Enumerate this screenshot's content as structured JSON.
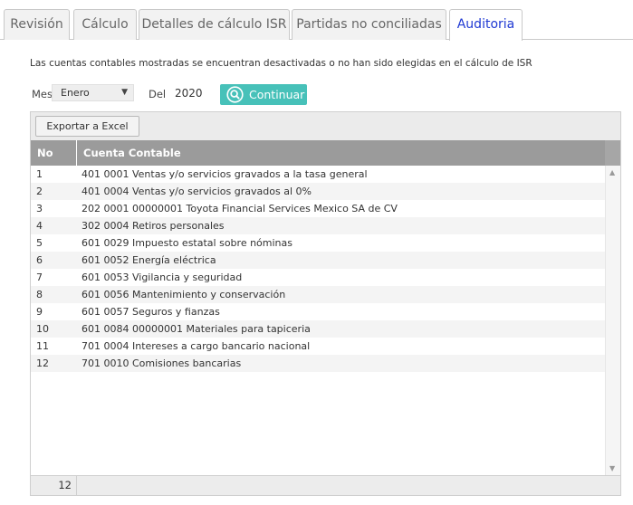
{
  "tabs": [
    {
      "label": "Revisión"
    },
    {
      "label": "Cálculo"
    },
    {
      "label": "Detalles de cálculo ISR"
    },
    {
      "label": "Partidas no conciliadas"
    },
    {
      "label": "Auditoria",
      "active": true
    }
  ],
  "notice": "Las cuentas contables mostradas se encuentran desactivadas o no han sido elegidas en el cálculo de ISR",
  "filters": {
    "mes_label": "Mes",
    "mes_value": "Enero",
    "del_label": "Del",
    "year": "2020",
    "continue_label": "Continuar"
  },
  "toolbar": {
    "export_label": "Exportar a Excel"
  },
  "table": {
    "headers": [
      "No",
      "Cuenta Contable"
    ],
    "rows": [
      {
        "no": "1",
        "cuenta": "401 0001 Ventas y/o servicios gravados a la tasa general"
      },
      {
        "no": "2",
        "cuenta": "401 0004 Ventas y/o servicios gravados al 0%"
      },
      {
        "no": "3",
        "cuenta": "202 0001 00000001 Toyota Financial Services Mexico SA de CV"
      },
      {
        "no": "4",
        "cuenta": "302 0004 Retiros personales"
      },
      {
        "no": "5",
        "cuenta": "601 0029 Impuesto estatal sobre nóminas"
      },
      {
        "no": "6",
        "cuenta": "601 0052 Energía eléctrica"
      },
      {
        "no": "7",
        "cuenta": "601 0053 Vigilancia y seguridad"
      },
      {
        "no": "8",
        "cuenta": "601 0056 Mantenimiento y conservación"
      },
      {
        "no": "9",
        "cuenta": "601 0057 Seguros y fianzas"
      },
      {
        "no": "10",
        "cuenta": "601 0084 00000001 Materiales para tapiceria"
      },
      {
        "no": "11",
        "cuenta": "701 0004 Intereses a cargo bancario nacional"
      },
      {
        "no": "12",
        "cuenta": "701 0010 Comisiones bancarias"
      }
    ],
    "footer_count": "12"
  },
  "colors": {
    "accent_button": "#47c1b9",
    "active_tab_text": "#1f39d3",
    "header_bg": "#9b9b9b"
  },
  "icons": {
    "continue": "search-icon",
    "scroll_up": "triangle-up-icon",
    "scroll_down": "triangle-down-icon",
    "dropdown": "triangle-down-icon"
  }
}
